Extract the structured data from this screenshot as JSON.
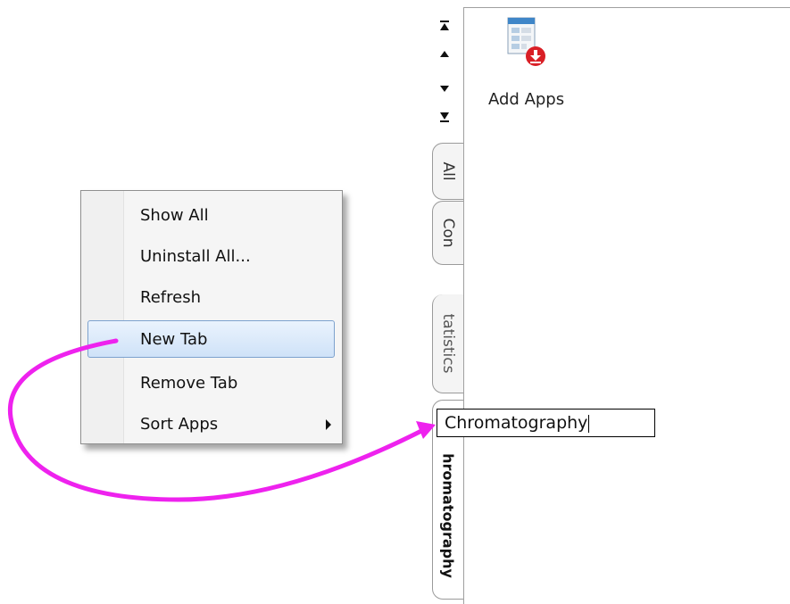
{
  "gallery": {
    "add_apps_label": "Add Apps",
    "tabs": [
      {
        "label": "All"
      },
      {
        "label": "Con"
      },
      {
        "label": "tatistics"
      },
      {
        "label": "hromatography"
      }
    ],
    "scroll_buttons": [
      "first-icon",
      "up-icon",
      "down-icon",
      "last-icon"
    ]
  },
  "rename_input": {
    "value": "Chromatography"
  },
  "context_menu": {
    "items": [
      {
        "label": "Show All"
      },
      {
        "label": "Uninstall All..."
      },
      {
        "label": "Refresh"
      },
      {
        "label": "New Tab",
        "highlighted": true
      },
      {
        "label": "Remove Tab"
      },
      {
        "label": "Sort Apps",
        "has_submenu": true
      }
    ]
  },
  "colors": {
    "annotation_arrow": "#ee22ee",
    "menu_highlight": "#cfe2f8",
    "badge_red": "#d91f26"
  }
}
